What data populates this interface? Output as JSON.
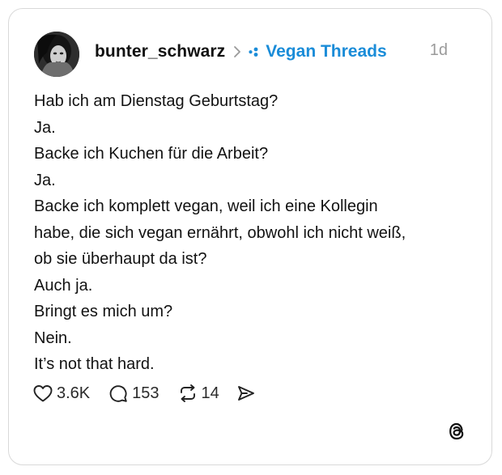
{
  "post": {
    "username": "bunter_schwarz",
    "community": "Vegan Threads",
    "timestamp": "1d",
    "lines": [
      "Hab ich am Dienstag Geburtstag?",
      "Ja.",
      "Backe ich Kuchen für die Arbeit?",
      "Ja.",
      "Backe ich komplett vegan, weil ich eine Kollegin",
      "habe, die sich vegan ernährt, obwohl ich nicht weiß,",
      "ob sie überhaupt da ist?",
      "Auch ja.",
      "Bringt es mich um?",
      "Nein.",
      "It’s not that hard."
    ]
  },
  "actions": {
    "likes": "3.6K",
    "replies": "153",
    "reposts": "14"
  },
  "icons": {
    "like": "heart-icon",
    "reply": "comment-icon",
    "repost": "repost-icon",
    "share": "send-icon",
    "brand": "threads-logo-icon"
  },
  "colors": {
    "community": "#1a8cd8",
    "muted": "#9a9a9a",
    "text": "#121212",
    "border": "#d9d9d9"
  }
}
